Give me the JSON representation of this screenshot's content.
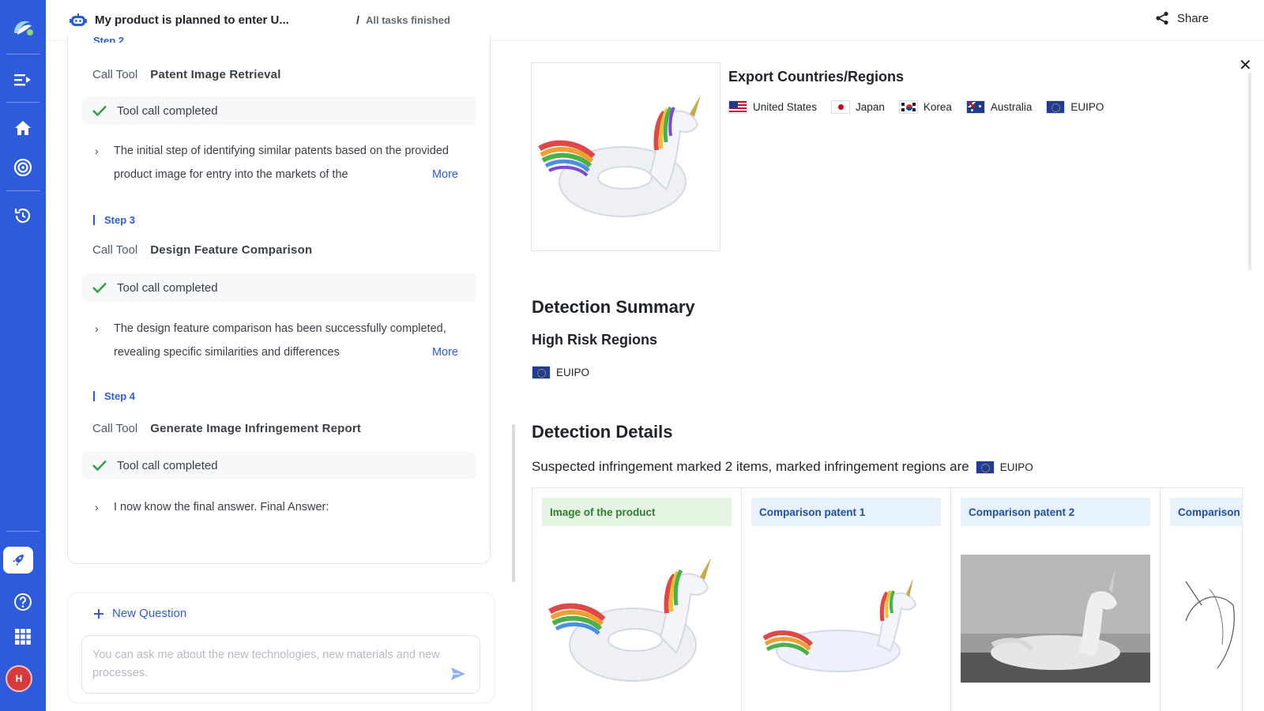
{
  "header": {
    "title": "My product is planned to enter U...",
    "separator": "/",
    "status": "All tasks finished",
    "share_label": "Share"
  },
  "steps": {
    "cut_label": "Step 2",
    "step2": {
      "call_prefix": "Call Tool",
      "tool_name": "Patent Image Retrieval",
      "completed": "Tool call completed",
      "summary": "The initial step of identifying similar patents based on the provided product image for entry into the markets of the",
      "more": "More"
    },
    "step3": {
      "label": "Step 3",
      "call_prefix": "Call Tool",
      "tool_name": "Design Feature Comparison",
      "completed": "Tool call completed",
      "summary": "The design feature comparison has been successfully completed, revealing specific similarities and differences",
      "more": "More"
    },
    "step4": {
      "label": "Step 4",
      "call_prefix": "Call Tool",
      "tool_name": "Generate Image Infringement Report",
      "completed": "Tool call completed",
      "summary": "I now know the final answer. Final Answer:"
    }
  },
  "ask": {
    "new_question": "New Question",
    "placeholder": "You can ask me about the new technologies, new materials and new processes."
  },
  "report": {
    "export_title": "Export Countries/Regions",
    "regions": [
      "United States",
      "Japan",
      "Korea",
      "Australia",
      "EUIPO"
    ],
    "summary_title": "Detection Summary",
    "high_risk_title": "High Risk Regions",
    "high_risk_region": "EUIPO",
    "details_title": "Detection Details",
    "suspected_text": "Suspected infringement marked 2 items, marked infringement regions are",
    "suspected_region": "EUIPO",
    "columns": [
      "Image of the product",
      "Comparison patent 1",
      "Comparison patent 2",
      "Comparison"
    ]
  },
  "user": {
    "avatar_initial": "H"
  },
  "colors": {
    "rail": "#2e5bdb",
    "accent": "#2e5bdb",
    "success": "#2e9e3f"
  }
}
